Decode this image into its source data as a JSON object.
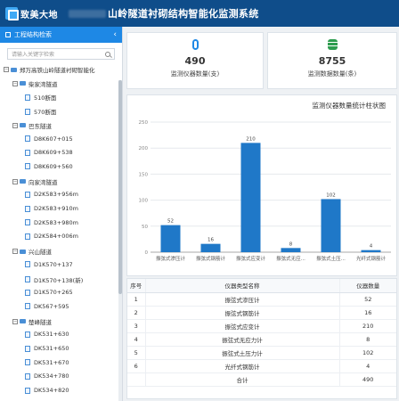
{
  "header": {
    "logo_text": "致美大地",
    "title": "山岭隧道衬砌结构智能化监测系统"
  },
  "sidebar": {
    "title": "工程结构检索",
    "collapse_icon": "chevron-left-icon",
    "search_placeholder": "请输入关键字检索",
    "tree": [
      {
        "level": 0,
        "type": "root",
        "label": "郑万高铁山岭隧道衬砌智能化"
      },
      {
        "level": 1,
        "type": "folder",
        "label": "柴家湾隧道"
      },
      {
        "level": 2,
        "type": "point",
        "label": "510断面"
      },
      {
        "level": 2,
        "type": "point",
        "label": "570断面"
      },
      {
        "level": 1,
        "type": "folder",
        "label": "巴东隧道"
      },
      {
        "level": 2,
        "type": "point",
        "label": "D8K607+015"
      },
      {
        "level": 2,
        "type": "point",
        "label": "D8K609+538"
      },
      {
        "level": 2,
        "type": "point",
        "label": "D8K609+560"
      },
      {
        "level": 1,
        "type": "folder",
        "label": "向家湾隧道"
      },
      {
        "level": 2,
        "type": "point",
        "label": "D2K583+956m"
      },
      {
        "level": 2,
        "type": "point",
        "label": "D2K583+910m"
      },
      {
        "level": 2,
        "type": "point",
        "label": "D2K583+980m"
      },
      {
        "level": 2,
        "type": "point",
        "label": "D2K584+006m"
      },
      {
        "level": 1,
        "type": "folder",
        "label": "兴山隧道"
      },
      {
        "level": 2,
        "type": "point",
        "label": "D1K570+137"
      },
      {
        "level": 2,
        "type": "point",
        "label": "D1K570+138(新)"
      },
      {
        "level": 2,
        "type": "point",
        "label": "D1K570+265"
      },
      {
        "level": 2,
        "type": "point",
        "label": "DK567+595"
      },
      {
        "level": 1,
        "type": "folder",
        "label": "楚峰隧道"
      },
      {
        "level": 2,
        "type": "point",
        "label": "DK531+630"
      },
      {
        "level": 2,
        "type": "point",
        "label": "DK531+650"
      },
      {
        "level": 2,
        "type": "point",
        "label": "DK531+670"
      },
      {
        "level": 2,
        "type": "point",
        "label": "DK534+780"
      },
      {
        "level": 2,
        "type": "point",
        "label": "DK534+820"
      }
    ]
  },
  "stats": [
    {
      "icon": "thermometer-icon",
      "value": "490",
      "label": "监测仪器数量(支)"
    },
    {
      "icon": "database-icon",
      "value": "8755",
      "label": "监测数据数量(条)"
    }
  ],
  "chart_data": {
    "type": "bar",
    "title": "监测仪器数量统计柱状图",
    "ylabel": "",
    "xlabel": "",
    "categories": [
      "振弦式渗压计",
      "振弦式钢筋计",
      "振弦式应变计",
      "振弦式无应...",
      "振弦式土压...",
      "光纤式钢筋计"
    ],
    "values": [
      52,
      16,
      210,
      8,
      102,
      4
    ],
    "ylim": [
      0,
      250
    ],
    "yticks": [
      0,
      50,
      100,
      150,
      200,
      250
    ],
    "color": "#1f78c8",
    "grid": true
  },
  "table": {
    "headers": [
      "序号",
      "仪器类型名称",
      "仪器数量"
    ],
    "rows": [
      [
        "1",
        "振弦式渗压计",
        "52"
      ],
      [
        "2",
        "振弦式钢筋计",
        "16"
      ],
      [
        "3",
        "振弦式应变计",
        "210"
      ],
      [
        "4",
        "振弦式无应力计",
        "8"
      ],
      [
        "5",
        "振弦式土压力计",
        "102"
      ],
      [
        "6",
        "光纤式钢筋计",
        "4"
      ]
    ],
    "total_label": "合计",
    "total_value": "490"
  }
}
